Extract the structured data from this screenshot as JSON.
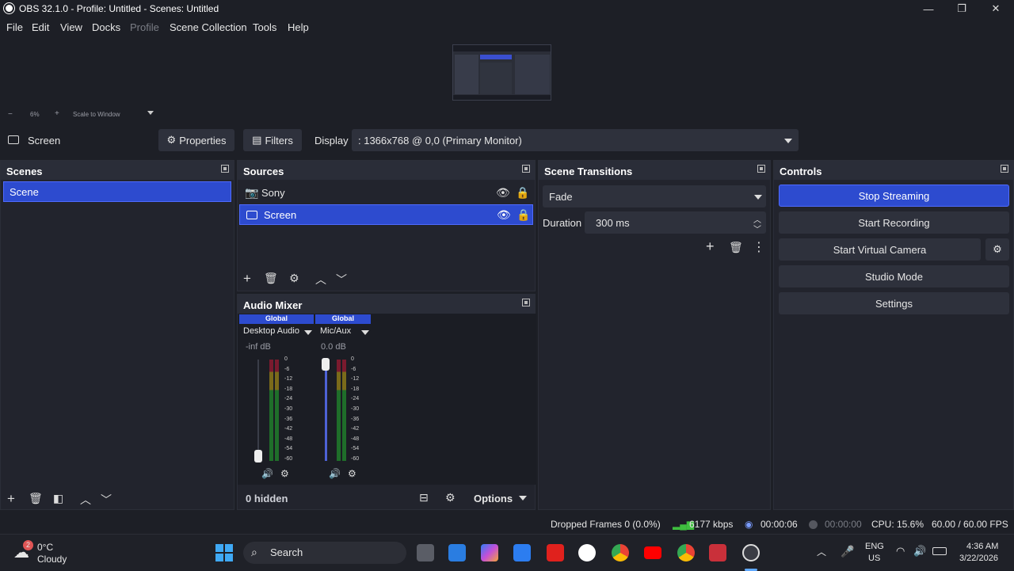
{
  "window": {
    "title": "OBS 32.1.0 - Profile: Untitled - Scenes: Untitled",
    "minimize": "—",
    "restore": "❐",
    "close": "✕"
  },
  "menu": [
    "File",
    "Edit",
    "View",
    "Docks",
    "Profile",
    "Scene Collection",
    "Tools",
    "Help"
  ],
  "zoom": {
    "minus": "−",
    "percent": "6%",
    "plus": "+",
    "mode": "Scale to Window"
  },
  "source_bar": {
    "current_source": "Screen",
    "properties": "Properties",
    "filters": "Filters",
    "display_label": "Display",
    "display_value": ": 1366x768 @ 0,0 (Primary Monitor)"
  },
  "scenes": {
    "title": "Scenes",
    "items": [
      "Scene"
    ]
  },
  "sources": {
    "title": "Sources",
    "items": [
      {
        "name": "Sony",
        "icon": "camera-icon",
        "selected": false
      },
      {
        "name": "Screen",
        "icon": "monitor-icon",
        "selected": true
      }
    ]
  },
  "audio_mixer": {
    "title": "Audio Mixer",
    "channels": [
      {
        "badge": "Global",
        "name": "Desktop Audio",
        "level": "-inf dB"
      },
      {
        "badge": "Global",
        "name": "Mic/Aux",
        "level": "0.0 dB"
      }
    ],
    "ticks": [
      "0",
      "-6",
      "-12",
      "-18",
      "-24",
      "-30",
      "-36",
      "-42",
      "-48",
      "-54",
      "-60"
    ],
    "hidden": "0 hidden",
    "options": "Options"
  },
  "transitions": {
    "title": "Scene Transitions",
    "type": "Fade",
    "duration_label": "Duration",
    "duration_value": "300 ms"
  },
  "controls": {
    "title": "Controls",
    "stop_streaming": "Stop Streaming",
    "start_recording": "Start Recording",
    "start_virtual_camera": "Start Virtual Camera",
    "studio_mode": "Studio Mode",
    "settings": "Settings"
  },
  "status": {
    "dropped": "Dropped Frames 0 (0.0%)",
    "bitrate": "6177 kbps",
    "stream_time": "00:00:06",
    "rec_time": "00:00:00",
    "cpu": "CPU: 15.6%",
    "fps": "60.00 / 60.00 FPS"
  },
  "taskbar": {
    "weather_badge": "2",
    "temp": "0°C",
    "condition": "Cloudy",
    "search": "Search",
    "lang": "ENG",
    "region": "US",
    "time": "4:36 AM",
    "date": "3/22/2026"
  },
  "colors": {
    "accent": "#2d4bcf",
    "panel": "#22242d",
    "bg": "#1d1f26"
  }
}
